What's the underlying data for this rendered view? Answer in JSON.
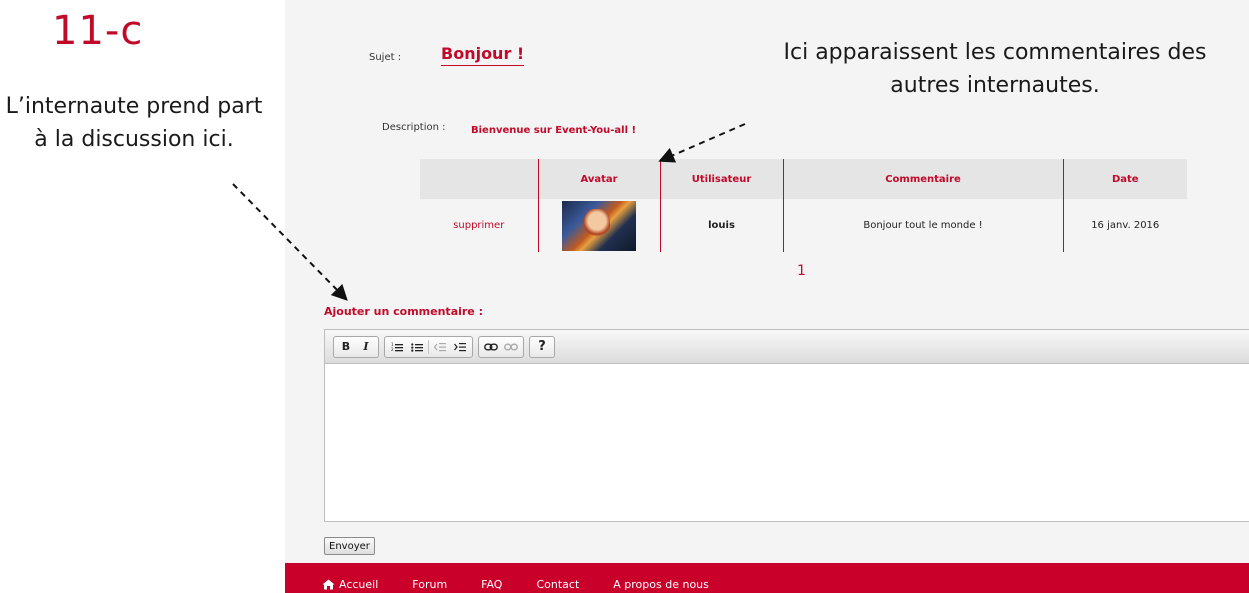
{
  "step_title": "11-c",
  "left_annotation": "L’internaute prend part à la discussion ici.",
  "top_annotation": "Ici apparaissent les commentaires des\nautres internautes.",
  "topic": {
    "subject_label": "Sujet :",
    "subject_value": "Bonjour !",
    "description_label": "Description :",
    "description_value": "Bienvenue sur Event-You-all !"
  },
  "comments_table": {
    "headers": [
      "",
      "Avatar",
      "Utilisateur",
      "Commentaire",
      "Date"
    ],
    "rows": [
      {
        "action": "supprimer",
        "user": "louis",
        "comment": "Bonjour tout le monde !",
        "date": "16 janv. 2016"
      }
    ]
  },
  "pagination": {
    "current_page": "1"
  },
  "add_comment": {
    "label": "Ajouter un commentaire :",
    "toolbar": [
      "bold-icon",
      "italic-icon",
      "ordered-list-icon",
      "unordered-list-icon",
      "outdent-icon",
      "indent-icon",
      "link-icon",
      "unlink-icon",
      "help-icon"
    ],
    "toolbar_text": {
      "bold": "B",
      "italic": "I",
      "help": "?"
    },
    "editor_value": "",
    "submit_label": "Envoyer"
  },
  "footer_nav": [
    "Accueil",
    "Forum",
    "FAQ",
    "Contact",
    "A propos de nous"
  ],
  "colors": {
    "accent": "#c00a2a",
    "footer_bg": "#c8002a",
    "page_bg": "#f4f4f4",
    "header_row_bg": "#e5e5e5"
  }
}
